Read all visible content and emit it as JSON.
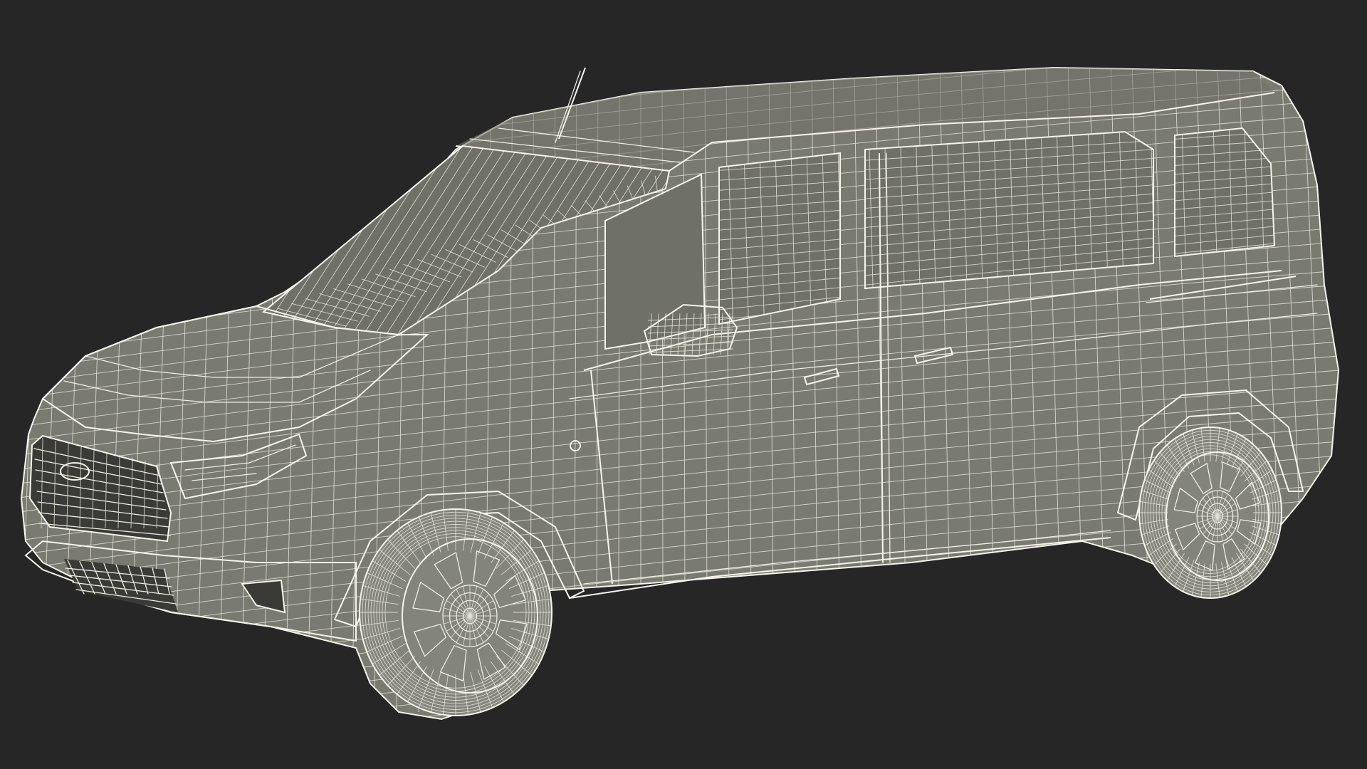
{
  "scene": {
    "background_color": "#262626",
    "model_fill_color": "#7a7b70",
    "wire_color": "#efeee4",
    "description_icon": "wireframe-van-render"
  }
}
